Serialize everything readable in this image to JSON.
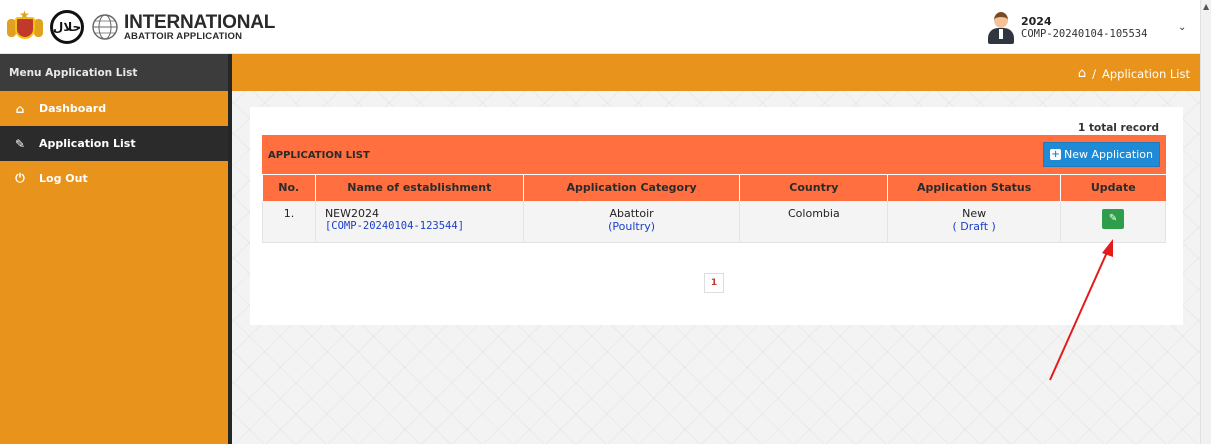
{
  "header": {
    "brand_line1": "INTERNATIONAL",
    "brand_line2": "ABATTOIR APPLICATION",
    "halal_mark": "حلال",
    "user_year": "2024",
    "user_code": "COMP-20240104-105534"
  },
  "sidebar": {
    "title": "Menu Application List",
    "items": [
      {
        "label": "Dashboard",
        "icon": "home-icon"
      },
      {
        "label": "Application List",
        "icon": "edit-icon"
      },
      {
        "label": "Log Out",
        "icon": "power-icon"
      }
    ]
  },
  "breadcrumb": {
    "current": "Application List",
    "separator": "/"
  },
  "list": {
    "total": "1 total record",
    "panel_title": "APPLICATION LIST",
    "new_button": "New Application",
    "columns": [
      "No.",
      "Name of establishment",
      "Application Category",
      "Country",
      "Application Status",
      "Update"
    ],
    "rows": [
      {
        "no": "1.",
        "name": "NEW2024",
        "ref": "[COMP-20240104-123544]",
        "category": "Abattoir",
        "subcategory": "(Poultry)",
        "country": "Colombia",
        "status": "New",
        "status_detail": "( Draft )"
      }
    ]
  },
  "pagination": {
    "current_page": "1"
  },
  "colors": {
    "orange": "#e8931b",
    "table_header": "#ff6f3f",
    "primary_button": "#1f8bd6",
    "update_button": "#2e9e4b",
    "annotation_arrow": "#e31b1b"
  }
}
